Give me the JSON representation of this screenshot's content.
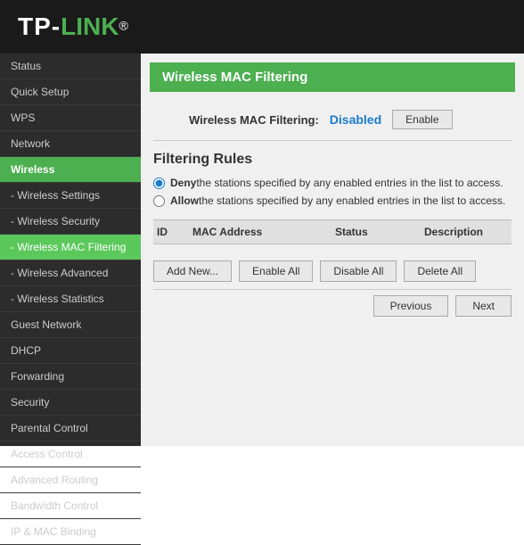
{
  "header": {
    "logo_tp": "TP-",
    "logo_link": "LINK",
    "logo_reg": "®"
  },
  "sidebar": {
    "items": [
      {
        "label": "Status",
        "active": false
      },
      {
        "label": "Quick Setup",
        "active": false
      },
      {
        "label": "WPS",
        "active": false
      },
      {
        "label": "Network",
        "active": false
      },
      {
        "label": "Wireless",
        "active": true
      },
      {
        "label": "- Wireless Settings",
        "active": false
      },
      {
        "label": "- Wireless Security",
        "active": false
      },
      {
        "label": "- Wireless MAC Filtering",
        "active": false,
        "highlighted": true
      },
      {
        "label": "- Wireless Advanced",
        "active": false
      },
      {
        "label": "- Wireless Statistics",
        "active": false
      },
      {
        "label": "Guest Network",
        "active": false
      },
      {
        "label": "DHCP",
        "active": false
      },
      {
        "label": "Forwarding",
        "active": false
      },
      {
        "label": "Security",
        "active": false
      },
      {
        "label": "Parental Control",
        "active": false
      },
      {
        "label": "Access Control",
        "active": false
      },
      {
        "label": "Advanced Routing",
        "active": false
      },
      {
        "label": "Bandwidth Control",
        "active": false
      },
      {
        "label": "IP & MAC Binding",
        "active": false
      }
    ]
  },
  "main": {
    "page_title": "Wireless MAC Filtering",
    "status_label": "Wireless MAC Filtering:",
    "status_value": "Disabled",
    "enable_btn": "Enable",
    "filtering_rules_title": "Filtering Rules",
    "radio_deny": "Deny",
    "radio_deny_text": " the stations specified by any enabled entries in the list to access.",
    "radio_allow": "Allow",
    "radio_allow_text": " the stations specified by any enabled entries in the list to access.",
    "table": {
      "columns": [
        "ID",
        "MAC Address",
        "Status",
        "Description"
      ]
    },
    "buttons": {
      "add_new": "Add New...",
      "enable_all": "Enable All",
      "disable_all": "Disable All",
      "delete_all": "Delete All"
    },
    "pagination": {
      "previous": "Previous",
      "next": "Next"
    }
  }
}
